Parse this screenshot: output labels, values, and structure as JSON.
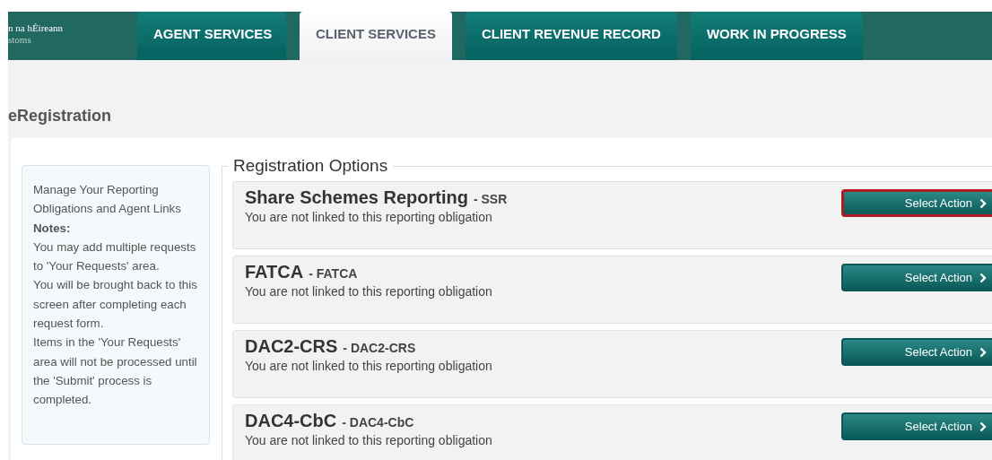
{
  "logo": {
    "line_1": "n na hÉireann",
    "line_2": "stoms"
  },
  "tabs": [
    {
      "label": "AGENT SERVICES",
      "selected": false
    },
    {
      "label": "CLIENT SERVICES",
      "selected": true
    },
    {
      "label": "CLIENT REVENUE RECORD",
      "selected": false
    },
    {
      "label": "WORK IN PROGRESS",
      "selected": false
    }
  ],
  "page_title": "eRegistration",
  "sidebar": {
    "intro": "Manage Your Reporting Obligations and Agent Links",
    "notes_label": "Notes:",
    "notes": [
      "You may add multiple requests to 'Your Requests' area.",
      "You will be brought back to this screen after completing each request form.",
      "Items in the 'Your Requests' area will not be processed until the 'Submit' process is completed."
    ]
  },
  "options": {
    "legend": "Registration Options",
    "items": [
      {
        "title": "Share Schemes Reporting",
        "code": "- SSR",
        "status": "You are not linked to this reporting obligation",
        "button": "Select Action",
        "highlighted": true
      },
      {
        "title": "FATCA",
        "code": "- FATCA",
        "status": "You are not linked to this reporting obligation",
        "button": "Select Action",
        "highlighted": false
      },
      {
        "title": "DAC2-CRS",
        "code": "- DAC2-CRS",
        "status": "You are not linked to this reporting obligation",
        "button": "Select Action",
        "highlighted": false
      },
      {
        "title": "DAC4-CbC",
        "code": "- DAC4-CbC",
        "status": "You are not linked to this reporting obligation",
        "button": "Select Action",
        "highlighted": false
      }
    ]
  }
}
